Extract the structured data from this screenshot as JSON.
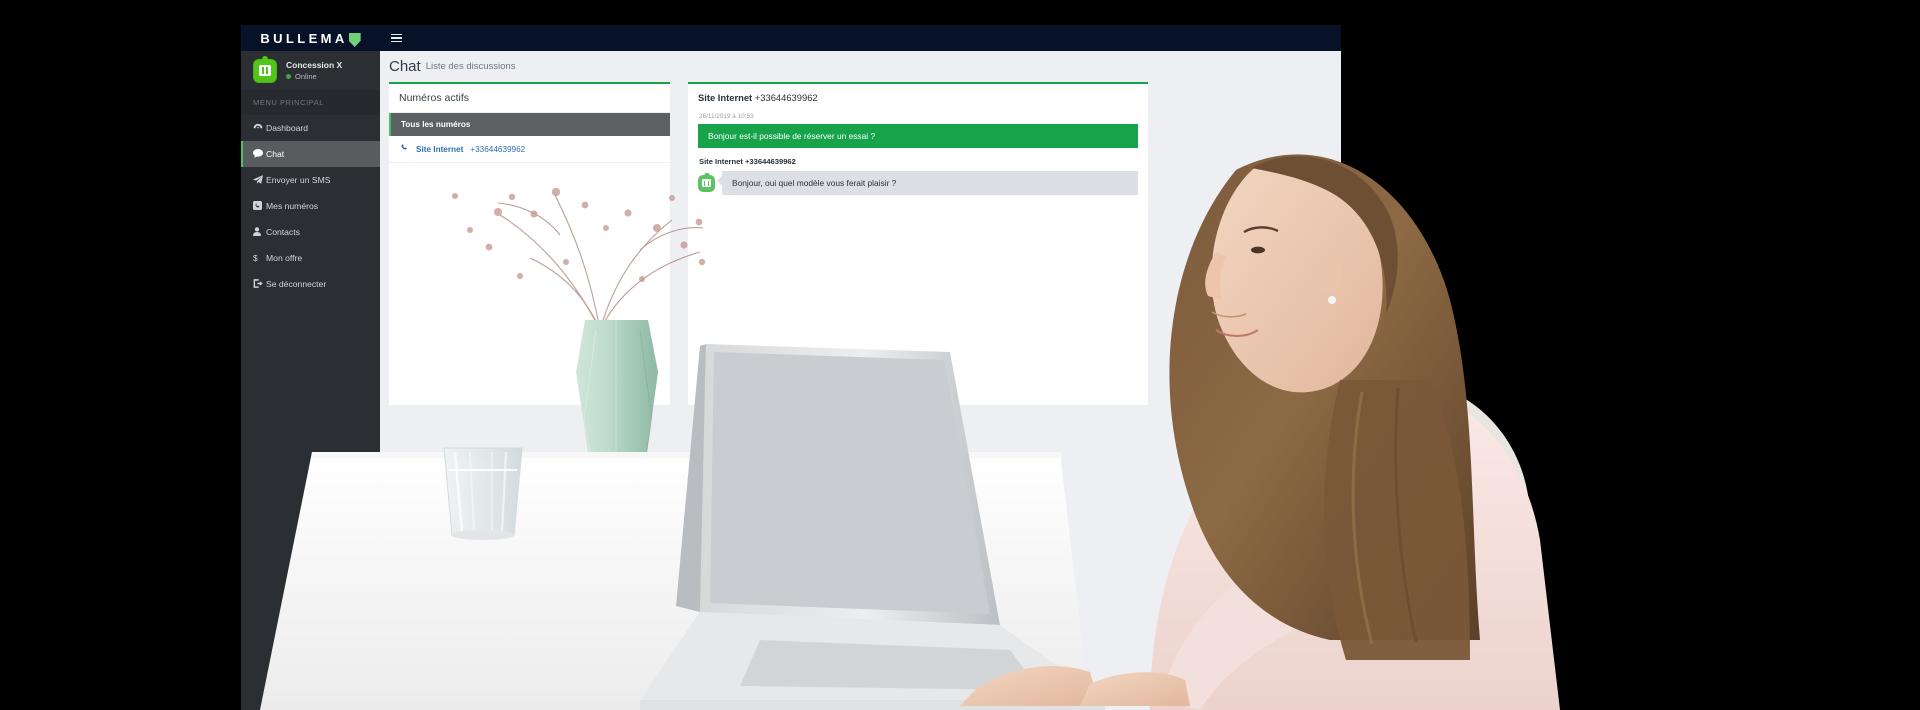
{
  "brand": {
    "name": "BULLEMA",
    "leaf_icon": "leaf-icon"
  },
  "topbar": {
    "menu_toggle_icon": "hamburger-icon"
  },
  "sidebar": {
    "user": {
      "name": "Concession X",
      "status": "Online",
      "avatar_icon": "robot-avatar-icon"
    },
    "menu_header": "MENU PRINCIPAL",
    "items": [
      {
        "label": "Dashboard",
        "icon": "dashboard-icon",
        "glyph": "⚝",
        "active": false
      },
      {
        "label": "Chat",
        "icon": "chat-icon",
        "glyph": "💬",
        "active": true
      },
      {
        "label": "Envoyer un SMS",
        "icon": "send-icon",
        "glyph": "➤",
        "active": false
      },
      {
        "label": "Mes numéros",
        "icon": "phone-square-icon",
        "glyph": "☎",
        "active": false
      },
      {
        "label": "Contacts",
        "icon": "user-icon",
        "glyph": "👤",
        "active": false
      },
      {
        "label": "Mon offre",
        "icon": "dollar-icon",
        "glyph": "$",
        "active": false
      },
      {
        "label": "Se déconnecter",
        "icon": "logout-icon",
        "glyph": "↪",
        "active": false
      }
    ]
  },
  "page": {
    "title": "Chat",
    "subtitle": "Liste des discussions"
  },
  "numbers_panel": {
    "title": "Numéros actifs",
    "all_label": "Tous les numéros",
    "rows": [
      {
        "icon": "phone-icon",
        "name": "Site Internet",
        "number": "+33644639962"
      }
    ]
  },
  "chat_panel": {
    "contact_name": "Site Internet",
    "contact_number": "+33644639962",
    "messages": [
      {
        "direction": "out",
        "timestamp": "26/11/2019 à 10:53",
        "text": "Bonjour est-il possible de réserver un essai ?"
      },
      {
        "direction": "in",
        "from": "Site Internet +33644639962",
        "avatar_icon": "robot-avatar-icon",
        "text": "Bonjour, oui quel modèle vous ferait plaisir ?"
      }
    ]
  },
  "colors": {
    "brand_navy": "#071228",
    "sidebar": "#2b2f34",
    "accent_green": "#16a34a",
    "bubble_in": "#dcdfe4",
    "link_blue": "#2f6fad",
    "page_bg": "#edeff3"
  }
}
